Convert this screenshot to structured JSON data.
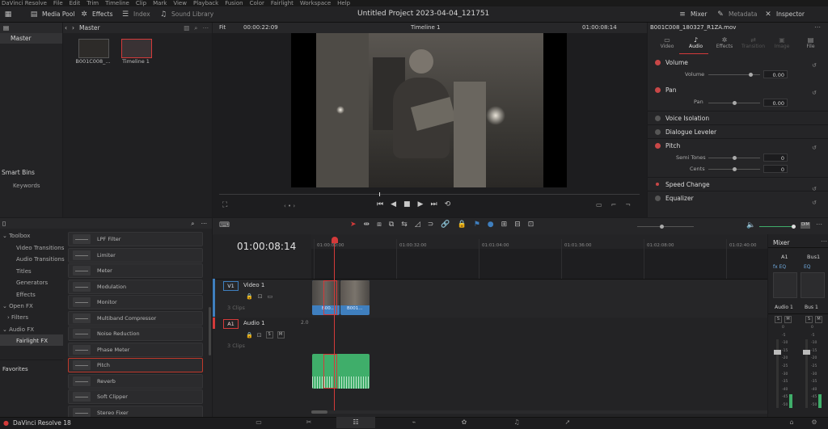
{
  "menu": [
    "DaVinci Resolve",
    "File",
    "Edit",
    "Trim",
    "Timeline",
    "Clip",
    "Mark",
    "View",
    "Playback",
    "Fusion",
    "Color",
    "Fairlight",
    "Workspace",
    "Help"
  ],
  "toolbar": {
    "media_pool": "Media Pool",
    "effects": "Effects",
    "index": "Index",
    "sound_library": "Sound Library",
    "project_title": "Untitled Project 2023-04-04_121751",
    "mixer": "Mixer",
    "metadata": "Metadata",
    "inspector": "Inspector"
  },
  "media_pool": {
    "bin_label": "Master",
    "root_bin": "Master",
    "smart_bins": "Smart Bins",
    "keywords": "Keywords",
    "clips": [
      {
        "name": "B001C008_..."
      },
      {
        "name": "Timeline 1"
      }
    ]
  },
  "viewer": {
    "mode": "Fit",
    "source_timecode": "00:00:22:09",
    "timeline_name": "Timeline 1",
    "record_timecode": "01:00:08:14"
  },
  "inspector": {
    "clip_name": "B001C008_180327_R1ZA.mov",
    "tabs": [
      "Video",
      "Audio",
      "Effects",
      "Transition",
      "Image",
      "File"
    ],
    "active_tab": "Audio",
    "sections": {
      "volume": {
        "title": "Volume",
        "param": "Volume",
        "value": "0.00"
      },
      "pan": {
        "title": "Pan",
        "param": "Pan",
        "value": "0.00"
      },
      "voice_isolation": "Voice Isolation",
      "dialogue_leveler": "Dialogue Leveler",
      "pitch": {
        "title": "Pitch",
        "semi_label": "Semi Tones",
        "semi_value": "0",
        "cents_label": "Cents",
        "cents_value": "0"
      },
      "speed_change": "Speed Change",
      "equalizer": "Equalizer"
    }
  },
  "effects_library": {
    "toolbox": "Toolbox",
    "video_transitions": "Video Transitions",
    "audio_transitions": "Audio Transitions",
    "titles": "Titles",
    "generators": "Generators",
    "effects": "Effects",
    "open_fx": "Open FX",
    "filters": "Filters",
    "audio_fx": "Audio FX",
    "fairlight_fx": "Fairlight FX",
    "favorites": "Favorites",
    "items": [
      "LPF Filter",
      "Limiter",
      "Meter",
      "Modulation",
      "Monitor",
      "Multiband Compressor",
      "Noise Reduction",
      "Phase Meter",
      "Pitch",
      "Reverb",
      "Soft Clipper",
      "Stereo Fixer"
    ],
    "selected": "Pitch"
  },
  "timeline": {
    "timecode": "01:00:08:14",
    "ruler": [
      "01:00:00:00",
      "01:00:32:00",
      "01:01:04:00",
      "01:01:36:00",
      "01:02:08:00",
      "01:02:40:00"
    ],
    "video_track": {
      "id": "V1",
      "name": "Video 1",
      "clips": "3 Clips"
    },
    "audio_track": {
      "id": "A1",
      "name": "Audio 1",
      "channels": "2.0",
      "clips": "3 Clips"
    },
    "clip_labels": [
      "B00...",
      "B001..."
    ]
  },
  "mixer": {
    "title": "Mixer",
    "channels": [
      "A1",
      "Bus1"
    ],
    "strips": [
      "Audio 1",
      "Bus 1"
    ],
    "eq": "EQ",
    "scale": [
      "0",
      "-5",
      "-10",
      "-15",
      "-20",
      "-25",
      "-30",
      "-35",
      "-40",
      "-45",
      "-50"
    ]
  },
  "footer": {
    "app_name": "DaVinci Resolve 18"
  },
  "colors": {
    "accent_red": "#d43a3a",
    "audio_green": "#3fae6a",
    "video_blue": "#3f7fbf"
  }
}
